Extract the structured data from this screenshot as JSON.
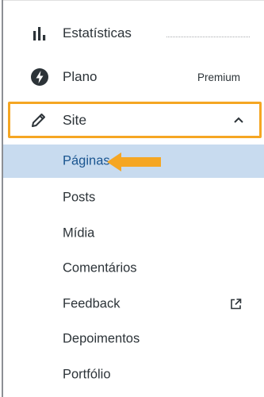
{
  "menu": {
    "stats": {
      "label": "Estatísticas",
      "icon": "bar-chart-icon"
    },
    "plan": {
      "label": "Plano",
      "badge": "Premium",
      "icon": "lightning-bolt-icon"
    },
    "site": {
      "label": "Site",
      "icon": "pencil-icon",
      "expanded": true,
      "highlight_color": "#f5a623"
    },
    "submenu": [
      {
        "label": "Páginas",
        "active": true
      },
      {
        "label": "Posts"
      },
      {
        "label": "Mídia"
      },
      {
        "label": "Comentários"
      },
      {
        "label": "Feedback",
        "icon": "external-link-icon"
      },
      {
        "label": "Depoimentos"
      },
      {
        "label": "Portfólio"
      }
    ]
  },
  "colors": {
    "active_bg": "#c8dbef",
    "active_text": "#1a5590",
    "callout_arrow": "#f5a623"
  }
}
